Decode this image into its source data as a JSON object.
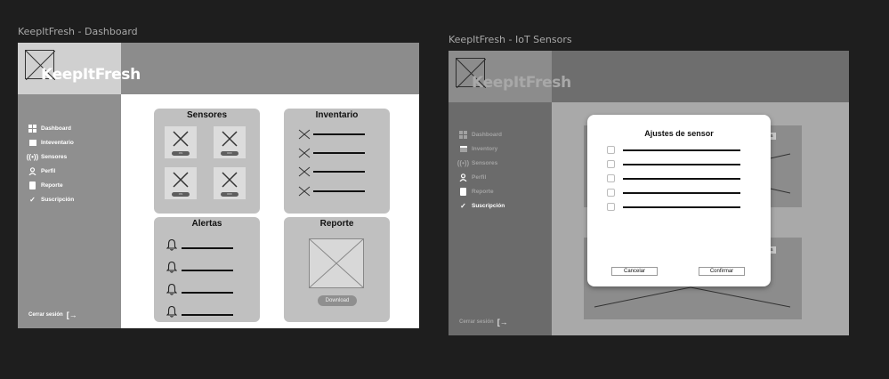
{
  "frames": [
    {
      "title": "KeepItFresh - Dashboard",
      "logo_text": "KeepItFresh",
      "sidebar": {
        "items": [
          {
            "label": "Dashboard",
            "icon": "dashboard-icon"
          },
          {
            "label": "Inteventario",
            "icon": "inventory-icon"
          },
          {
            "label": "Sensores",
            "icon": "sensor-icon"
          },
          {
            "label": "Perfil",
            "icon": "user-icon"
          },
          {
            "label": "Reporte",
            "icon": "document-icon"
          },
          {
            "label": "Suscripción",
            "icon": "check-icon"
          }
        ],
        "logout_label": "Cerrar sesión"
      },
      "cards": {
        "sensores": {
          "title": "Sensores",
          "tiles": [
            {
              "status": "ON"
            },
            {
              "status": "OFF"
            },
            {
              "status": "ON"
            },
            {
              "status": "OFF"
            }
          ]
        },
        "inventario": {
          "title": "Inventario",
          "rows": 4
        },
        "alertas": {
          "title": "Alertas",
          "rows": 4
        },
        "reporte": {
          "title": "Reporte",
          "button_label": "Download"
        }
      }
    },
    {
      "title": "KeepItFresh - IoT Sensors",
      "logo_text": "KeepItFresh",
      "sidebar": {
        "items": [
          {
            "label": "Dashboard",
            "icon": "dashboard-icon"
          },
          {
            "label": "Inventory",
            "icon": "inventory-icon"
          },
          {
            "label": "Sensores",
            "icon": "sensor-icon"
          },
          {
            "label": "Perfil",
            "icon": "user-icon"
          },
          {
            "label": "Reporte",
            "icon": "document-icon"
          },
          {
            "label": "Suscripción",
            "icon": "check-icon",
            "active": true
          }
        ],
        "logout_label": "Cerrar sesión"
      },
      "background_tags": [
        "ga",
        "ga"
      ],
      "modal": {
        "title": "Ajustes de sensor",
        "rows": 5,
        "cancel_label": "Cancelar",
        "confirm_label": "Confirmar"
      }
    }
  ],
  "colors": {
    "canvas": "#1e1e1e",
    "frame1_header": "#8c8c8c",
    "frame1_sidebar": "#8f8f8f",
    "card": "#c0c0c0",
    "frame2_overlay": "#a9a9a9",
    "modal": "#ffffff"
  }
}
